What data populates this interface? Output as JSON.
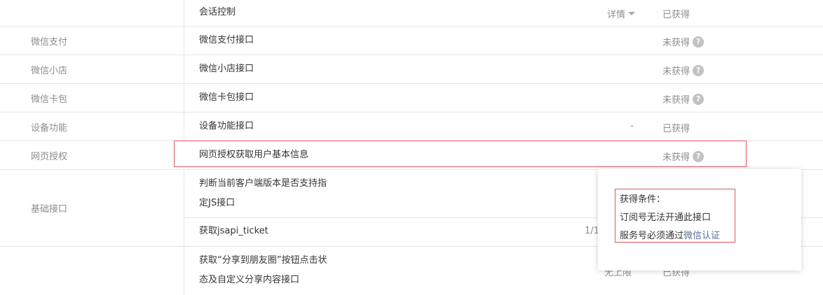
{
  "table": {
    "rows": [
      {
        "category": "",
        "name": "会话控制",
        "detail_label": "详情",
        "status": "已获得"
      },
      {
        "category": "微信支付",
        "name": "微信支付接口",
        "status": "未获得"
      },
      {
        "category": "微信小店",
        "name": "微信小店接口",
        "status": "未获得"
      },
      {
        "category": "微信卡包",
        "name": "微信卡包接口",
        "status": "未获得"
      },
      {
        "category": "设备功能",
        "name": "设备功能接口",
        "limit": "-",
        "status": "已获得"
      },
      {
        "category": "网页授权",
        "name": "网页授权获取用户基本信息",
        "status": "未获得"
      },
      {
        "category": "基础接口",
        "name_line1": "判断当前客户端版本是否支持指",
        "name_line2": "定JS接口"
      },
      {
        "name": "获取jsapi_ticket",
        "limit_partial": "1/1"
      },
      {
        "category": "",
        "name_line1": "获取“分享到朋友圈”按钮点击状",
        "name_line2": "态及自定义分享内容接口",
        "limit_partial": "无上限",
        "status": "已获得"
      }
    ],
    "help_symbol": "?"
  },
  "popover": {
    "title": "获得条件：",
    "line1": "订阅号无法开通此接口",
    "line2_prefix": "服务号必须通过",
    "line2_link": "微信认证"
  }
}
